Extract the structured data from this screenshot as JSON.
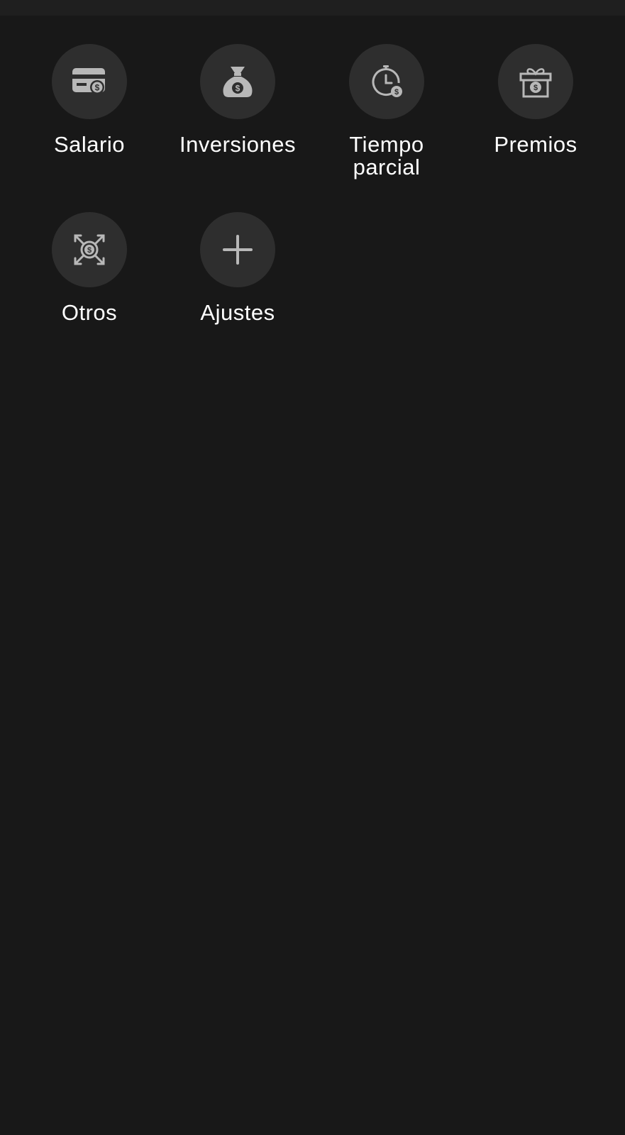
{
  "categories": [
    {
      "label": "Salario",
      "icon": "card-dollar-icon"
    },
    {
      "label": "Inversiones",
      "icon": "money-bag-icon"
    },
    {
      "label": "Tiempo\nparcial",
      "icon": "clock-dollar-icon"
    },
    {
      "label": "Premios",
      "icon": "gift-dollar-icon"
    },
    {
      "label": "Otros",
      "icon": "coin-arrows-icon"
    },
    {
      "label": "Ajustes",
      "icon": "plus-icon"
    }
  ],
  "colors": {
    "background": "#181818",
    "top_bar": "#1f1f1f",
    "circle": "#2e2e2e",
    "icon": "#b8b8b8",
    "label": "#ffffff"
  }
}
